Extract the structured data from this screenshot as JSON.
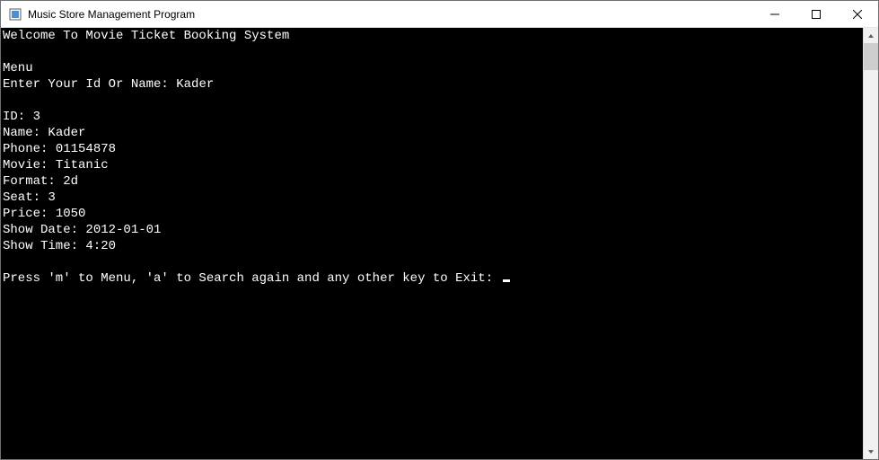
{
  "window": {
    "title": "Music Store Management Program"
  },
  "console": {
    "welcome": "Welcome To Movie Ticket Booking System",
    "menu_label": "Menu",
    "prompt_label": "Enter Your Id Or Name: ",
    "prompt_value": "Kader",
    "record": {
      "id_label": "ID: ",
      "id_value": "3",
      "name_label": "Name: ",
      "name_value": "Kader",
      "phone_label": "Phone: ",
      "phone_value": "01154878",
      "movie_label": "Movie: ",
      "movie_value": "Titanic",
      "format_label": "Format: ",
      "format_value": "2d",
      "seat_label": "Seat: ",
      "seat_value": "3",
      "price_label": "Price: ",
      "price_value": "1050",
      "showdate_label": "Show Date: ",
      "showdate_value": "2012-01-01",
      "showtime_label": "Show Time: ",
      "showtime_value": "4:20"
    },
    "footer_prompt": "Press 'm' to Menu, 'a' to Search again and any other key to Exit: "
  }
}
